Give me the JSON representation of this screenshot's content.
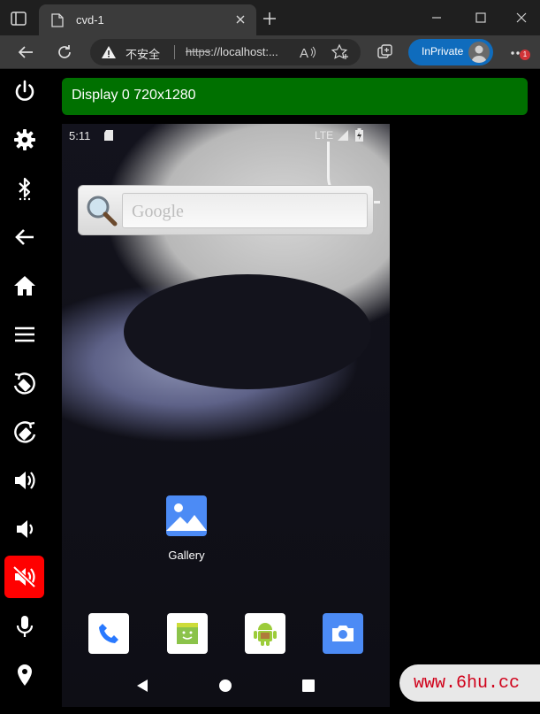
{
  "browser": {
    "tab_title": "cvd-1",
    "insecure_label": "不安全",
    "url_scheme": "https",
    "url_rest": "://localhost:...",
    "inprivate_label": "InPrivate",
    "badge_count": "1"
  },
  "sidebar": {
    "buttons": [
      {
        "name": "power",
        "icon": "power-icon"
      },
      {
        "name": "settings",
        "icon": "gear-icon"
      },
      {
        "name": "bluetooth",
        "icon": "bluetooth-icon"
      },
      {
        "name": "back",
        "icon": "arrow-left-icon"
      },
      {
        "name": "home",
        "icon": "home-icon"
      },
      {
        "name": "menu",
        "icon": "menu-icon"
      },
      {
        "name": "rotate-left",
        "icon": "rotate-left-icon"
      },
      {
        "name": "rotate-right",
        "icon": "rotate-right-icon"
      },
      {
        "name": "volume-up",
        "icon": "volume-up-icon"
      },
      {
        "name": "volume-down",
        "icon": "volume-down-icon"
      },
      {
        "name": "volume-mute",
        "icon": "volume-mute-icon",
        "active": true
      },
      {
        "name": "microphone",
        "icon": "microphone-icon"
      },
      {
        "name": "location",
        "icon": "location-icon"
      }
    ],
    "active_color": "#ff0000"
  },
  "display": {
    "title": "Display 0 720x1280",
    "header_color": "#007000"
  },
  "android": {
    "time": "5:11",
    "network": "LTE",
    "search_placeholder": "Google",
    "apps": [
      {
        "label": "Gallery",
        "icon": "gallery-icon"
      }
    ],
    "dock": [
      {
        "name": "phone",
        "icon": "phone-icon"
      },
      {
        "name": "messaging",
        "icon": "messaging-icon"
      },
      {
        "name": "android-app",
        "icon": "android-icon"
      },
      {
        "name": "camera",
        "icon": "camera-icon"
      }
    ],
    "nav": [
      "back-triangle-icon",
      "home-circle-icon",
      "recents-square-icon"
    ]
  },
  "watermark": {
    "text": "www.6hu.cc"
  }
}
